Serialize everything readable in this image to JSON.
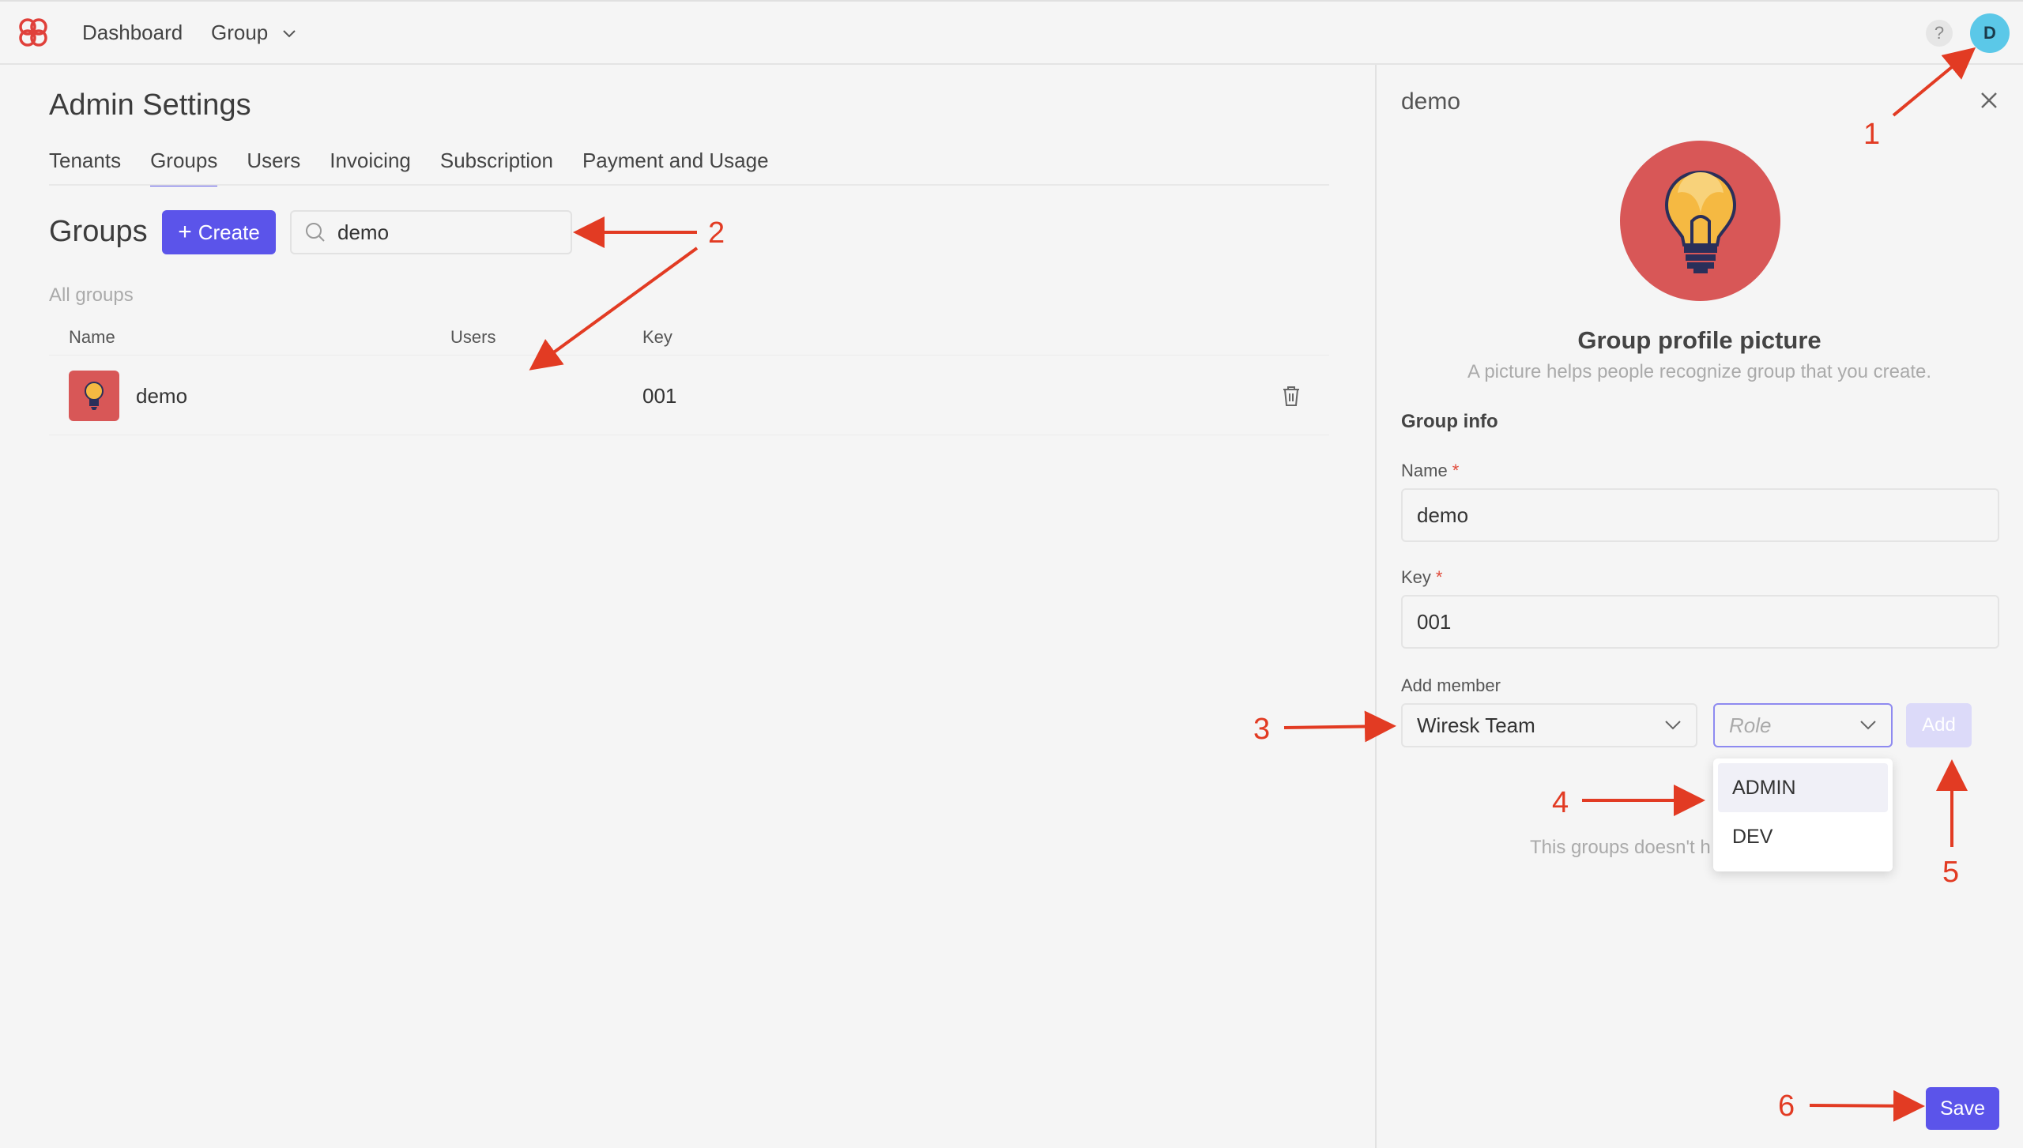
{
  "topbar": {
    "nav": [
      {
        "label": "Dashboard"
      },
      {
        "label": "Group"
      }
    ],
    "help_label": "?",
    "avatar_initial": "D"
  },
  "page": {
    "title": "Admin Settings",
    "tabs": [
      {
        "label": "Tenants"
      },
      {
        "label": "Groups",
        "active": true
      },
      {
        "label": "Users"
      },
      {
        "label": "Invoicing"
      },
      {
        "label": "Subscription"
      },
      {
        "label": "Payment and Usage"
      }
    ]
  },
  "groups": {
    "heading": "Groups",
    "create_label": "Create",
    "search_value": "demo",
    "section_label": "All groups",
    "columns": [
      "Name",
      "Users",
      "Key"
    ],
    "rows": [
      {
        "name": "demo",
        "users": "",
        "key": "001"
      }
    ]
  },
  "panel": {
    "title": "demo",
    "profile_title": "Group profile picture",
    "profile_subtitle": "A picture helps people recognize group that you create.",
    "group_info_label": "Group info",
    "name_label": "Name",
    "name_value": "demo",
    "key_label": "Key",
    "key_value": "001",
    "add_member_label": "Add member",
    "member_value": "Wiresk Team",
    "role_placeholder": "Role",
    "add_label": "Add",
    "empty_message": "This groups doesn't h",
    "role_options": [
      "ADMIN",
      "DEV"
    ],
    "save_label": "Save"
  },
  "annotations": [
    "1",
    "2",
    "3",
    "4",
    "5",
    "6"
  ],
  "colors": {
    "accent": "#5b54ea",
    "avatar": "#5bc8e8",
    "group_icon_bg": "#d85757",
    "annotation": "#e23b23"
  }
}
